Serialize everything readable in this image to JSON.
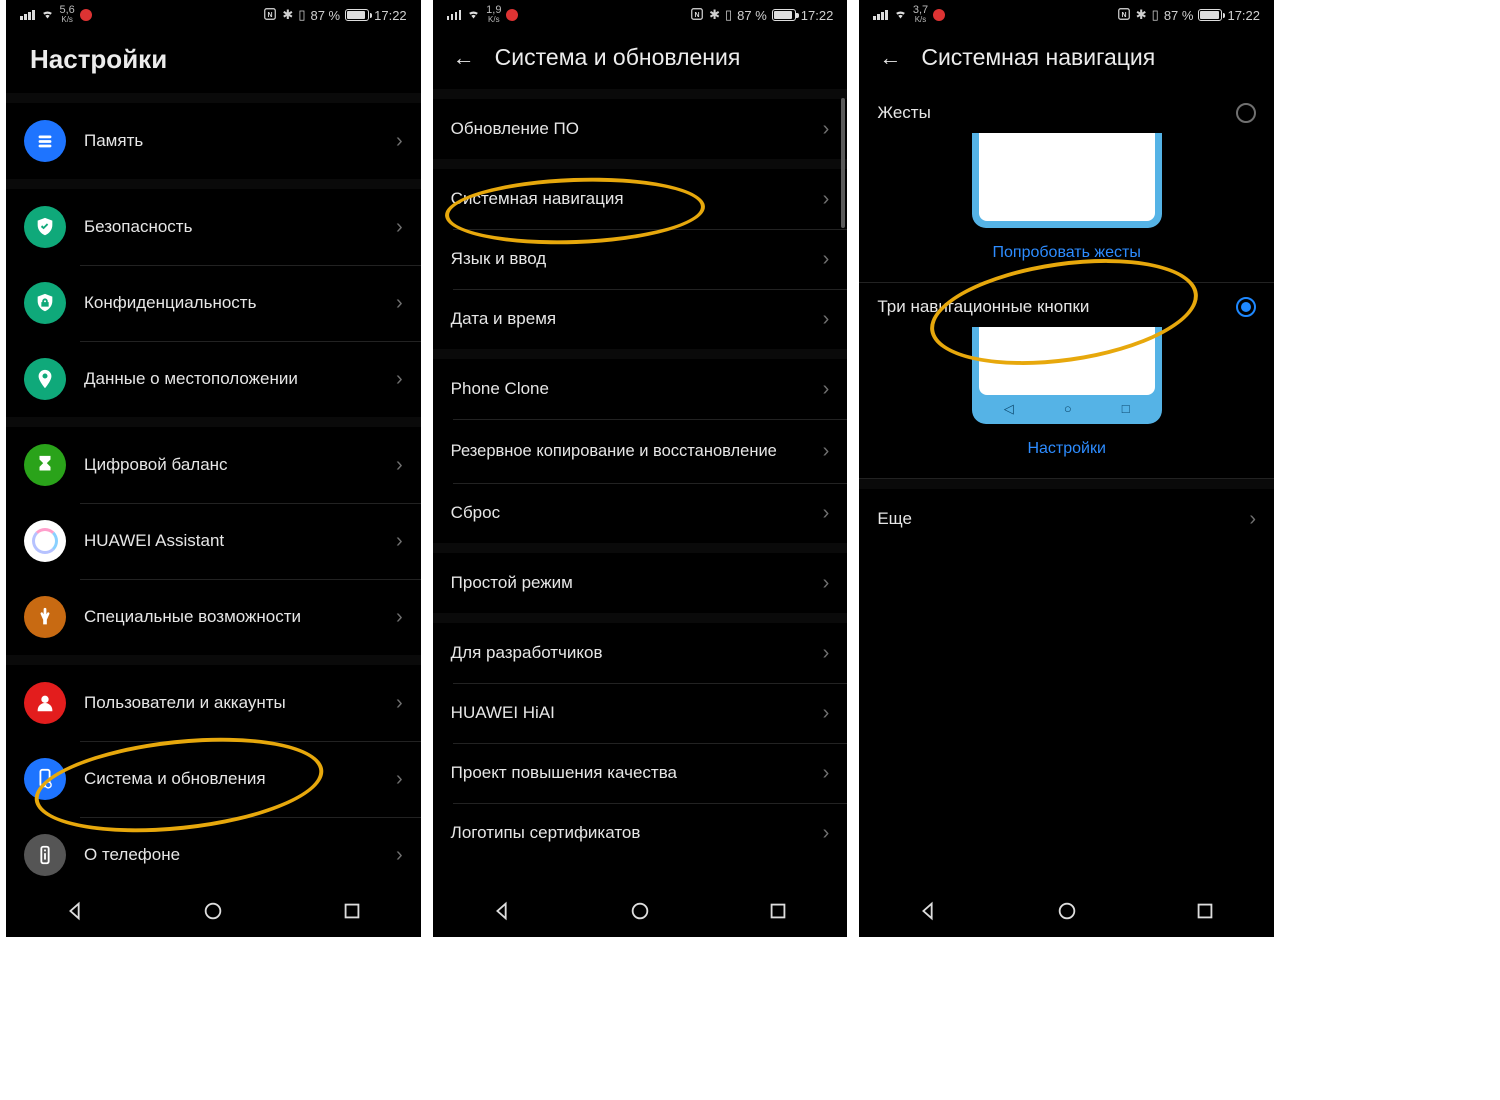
{
  "status": {
    "signal": "▮▮▮▮",
    "wifi": "wifi-icon",
    "speed1": "5,6",
    "speed2": "1,9",
    "speed3": "3,7",
    "speed_unit": "K/s",
    "nfc": "N",
    "bt": "✱",
    "vibrate": "⫽",
    "battery_pct": "87 %",
    "time": "17:22"
  },
  "screen1": {
    "title": "Настройки",
    "items": [
      {
        "label": "Память",
        "icon": "memory"
      },
      {
        "label": "Безопасность",
        "icon": "security"
      },
      {
        "label": "Конфиденциальность",
        "icon": "privacy"
      },
      {
        "label": "Данные о местоположении",
        "icon": "location"
      },
      {
        "label": "Цифровой баланс",
        "icon": "digital"
      },
      {
        "label": "HUAWEI Assistant",
        "icon": "assistant"
      },
      {
        "label": "Специальные возможности",
        "icon": "accessibility"
      },
      {
        "label": "Пользователи и аккаунты",
        "icon": "users"
      },
      {
        "label": "Система и обновления",
        "icon": "system"
      },
      {
        "label": "О телефоне",
        "icon": "about"
      }
    ]
  },
  "screen2": {
    "title": "Система и обновления",
    "items": [
      "Обновление ПО",
      "Системная навигация",
      "Язык и ввод",
      "Дата и время",
      "Phone Clone",
      "Резервное копирование и восстановление",
      "Сброс",
      "Простой режим",
      "Для разработчиков",
      "HUAWEI HiAI",
      "Проект повышения качества",
      "Логотипы сертификатов"
    ]
  },
  "screen3": {
    "title": "Системная навигация",
    "opt_gestures": "Жесты",
    "opt_gestures_link": "Попробовать жесты",
    "opt_three": "Три навигационные кнопки",
    "opt_three_link": "Настройки",
    "more": "Еще"
  },
  "colors": {
    "annotation": "#e7a80c",
    "accent_blue": "#1e88ff",
    "link_blue": "#2d8cff"
  }
}
